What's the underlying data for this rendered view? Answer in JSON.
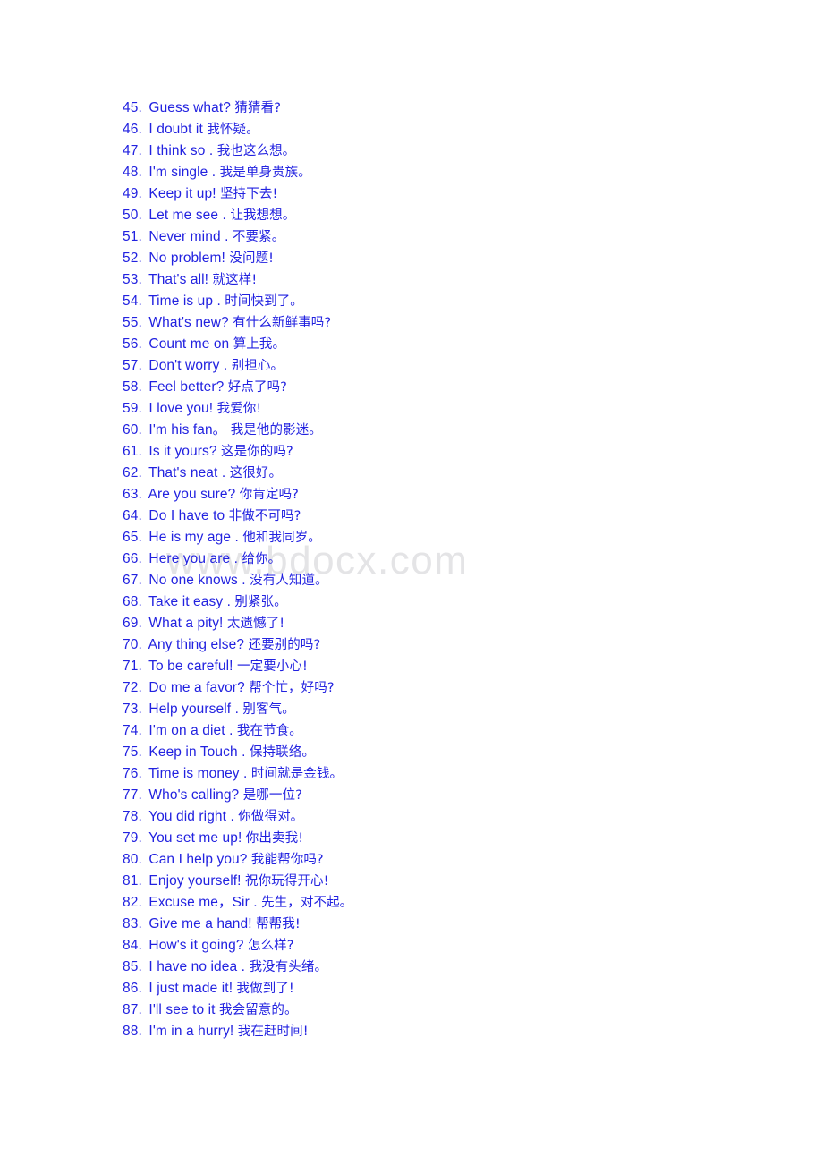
{
  "document": {
    "watermark": "www.bdocx.com",
    "text_color": "#2222e0",
    "watermark_color": "#e4e4e6",
    "background_color": "#ffffff"
  },
  "lines": [
    {
      "num": "45.",
      "en": "Guess what?",
      "zh": "猜猜看?"
    },
    {
      "num": "46.",
      "en": "I doubt it",
      "zh": "我怀疑。"
    },
    {
      "num": "47.",
      "en": "I think so .",
      "zh": "我也这么想。"
    },
    {
      "num": "48.",
      "en": "I'm single .",
      "zh": "我是单身贵族。"
    },
    {
      "num": "49.",
      "en": "Keep it up!",
      "zh": "坚持下去!"
    },
    {
      "num": "50.",
      "en": "Let me see .",
      "zh": "让我想想。"
    },
    {
      "num": "51.",
      "en": "Never mind .",
      "zh": "不要紧。"
    },
    {
      "num": "52.",
      "en": "No problem!",
      "zh": "没问题!"
    },
    {
      "num": "53.",
      "en": "That's all!",
      "zh": "就这样!"
    },
    {
      "num": "54.",
      "en": "Time is up .",
      "zh": "时间快到了。"
    },
    {
      "num": "55.",
      "en": "What's new?",
      "zh": "有什么新鲜事吗?"
    },
    {
      "num": "56.",
      "en": "Count me on",
      "zh": "算上我。"
    },
    {
      "num": "57.",
      "en": "Don't worry .",
      "zh": "别担心。"
    },
    {
      "num": "58.",
      "en": "Feel better?",
      "zh": "好点了吗?"
    },
    {
      "num": "59.",
      "en": "I love you!",
      "zh": "我爱你!"
    },
    {
      "num": "60.",
      "en": "I'm his fan。",
      "zh": "我是他的影迷。"
    },
    {
      "num": "61.",
      "en": "Is it yours?",
      "zh": "这是你的吗?"
    },
    {
      "num": "62.",
      "en": "That's neat .",
      "zh": "这很好。"
    },
    {
      "num": "63.",
      "en": "Are you sure?",
      "zh": "你肯定吗?"
    },
    {
      "num": "64.",
      "en": "Do I have to",
      "zh": "非做不可吗?"
    },
    {
      "num": "65.",
      "en": "He is my age .",
      "zh": "他和我同岁。"
    },
    {
      "num": "66.",
      "en": "Here you are .",
      "zh": "给你。"
    },
    {
      "num": "67.",
      "en": "No one knows .",
      "zh": "没有人知道。"
    },
    {
      "num": "68.",
      "en": "Take it easy .",
      "zh": "别紧张。"
    },
    {
      "num": "69.",
      "en": "What a pity!",
      "zh": "太遗憾了!"
    },
    {
      "num": "70.",
      "en": "Any thing else?",
      "zh": "还要别的吗?"
    },
    {
      "num": "71.",
      "en": "To be careful!",
      "zh": "一定要小心!"
    },
    {
      "num": "72.",
      "en": "Do me a favor?",
      "zh": "帮个忙，好吗?"
    },
    {
      "num": "73.",
      "en": "Help yourself .",
      "zh": "别客气。"
    },
    {
      "num": "74.",
      "en": "I'm on a diet .",
      "zh": "我在节食。"
    },
    {
      "num": "75.",
      "en": "Keep in Touch .",
      "zh": "保持联络。"
    },
    {
      "num": "76.",
      "en": "Time is money .",
      "zh": "时间就是金钱。"
    },
    {
      "num": "77.",
      "en": "Who's calling?",
      "zh": "是哪一位?"
    },
    {
      "num": "78.",
      "en": "You did right .",
      "zh": "你做得对。"
    },
    {
      "num": "79.",
      "en": "You set me up!",
      "zh": "你出卖我!"
    },
    {
      "num": "80.",
      "en": "Can I help you?",
      "zh": "我能帮你吗?"
    },
    {
      "num": "81.",
      "en": "Enjoy yourself!",
      "zh": "祝你玩得开心!"
    },
    {
      "num": "82.",
      "en": "Excuse me，Sir .",
      "zh": "先生，对不起。"
    },
    {
      "num": "83.",
      "en": "Give me a hand!",
      "zh": "帮帮我!"
    },
    {
      "num": "84.",
      "en": "How's it going?",
      "zh": "怎么样?"
    },
    {
      "num": "85.",
      "en": "I have no idea .",
      "zh": "我没有头绪。"
    },
    {
      "num": "86.",
      "en": "I just made it!",
      "zh": "我做到了!"
    },
    {
      "num": "87.",
      "en": "I'll see to it",
      "zh": "我会留意的。"
    },
    {
      "num": "88.",
      "en": "I'm in a hurry!",
      "zh": "我在赶时间!"
    }
  ]
}
